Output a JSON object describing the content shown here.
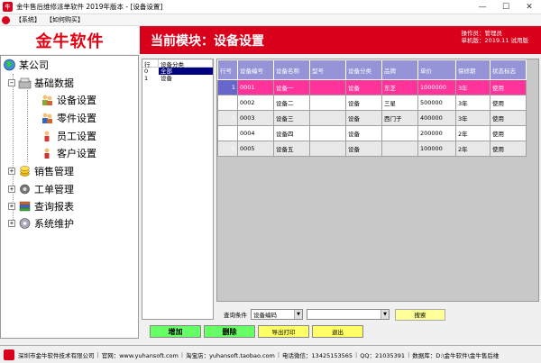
{
  "window": {
    "icon": "牛",
    "title": "金牛售后维修派单软件 2019年版本 - [设备设置]",
    "minimize": "—",
    "maximize": "☐",
    "close": "✕"
  },
  "menu": [
    {
      "label": "【系统】"
    },
    {
      "label": "【如何购买】"
    }
  ],
  "header": {
    "logo": "金牛软件",
    "module_title": "当前模块：设备设置",
    "operator_line": "操作员：管理员",
    "machine_line": "单机版：2019.11 试用版"
  },
  "tree": {
    "root": "某公司",
    "groups": [
      {
        "label": "基础数据",
        "expanded": true,
        "children": [
          "设备设置",
          "零件设置",
          "员工设置",
          "客户设置"
        ]
      },
      {
        "label": "销售管理"
      },
      {
        "label": "工单管理"
      },
      {
        "label": "查询报表"
      },
      {
        "label": "系统维护"
      }
    ]
  },
  "category": {
    "headers": [
      "行",
      "设备分类"
    ],
    "rows": [
      {
        "no": "0",
        "name": "全部"
      },
      {
        "no": "1",
        "name": "设备"
      }
    ]
  },
  "grid": {
    "headers": [
      "行号",
      "设备编号",
      "设备名称",
      "型号",
      "设备分类",
      "品牌",
      "单价",
      "保修期",
      "状态标志"
    ],
    "rows": [
      [
        "1",
        "0001",
        "设备一",
        "",
        "设备",
        "东芝",
        "1000000",
        "3年",
        "使用"
      ],
      [
        "2",
        "0002",
        "设备二",
        "",
        "设备",
        "三星",
        "500000",
        "3年",
        "使用"
      ],
      [
        "3",
        "0003",
        "设备三",
        "",
        "设备",
        "西门子",
        "400000",
        "3年",
        "使用"
      ],
      [
        "4",
        "0004",
        "设备四",
        "",
        "设备",
        "",
        "200000",
        "2年",
        "使用"
      ],
      [
        "5",
        "0005",
        "设备五",
        "",
        "设备",
        "",
        "100000",
        "2年",
        "使用"
      ]
    ]
  },
  "query": {
    "label": "查询条件",
    "field": "设备编码",
    "value": "",
    "search": "搜索"
  },
  "actions": {
    "add": "增加",
    "delete": "删除",
    "export": "导出打印",
    "exit": "退出"
  },
  "status": {
    "company": "深圳市金牛软件技术有限公司",
    "website": "官网：www.yuhansoft.com",
    "taobao": "淘宝店：yuhansoft.taobao.com",
    "phone": "电话微信：13425153565",
    "qq": "QQ：21035391",
    "database": "数据库：D:\\金牛软件\\金牛售后维"
  }
}
